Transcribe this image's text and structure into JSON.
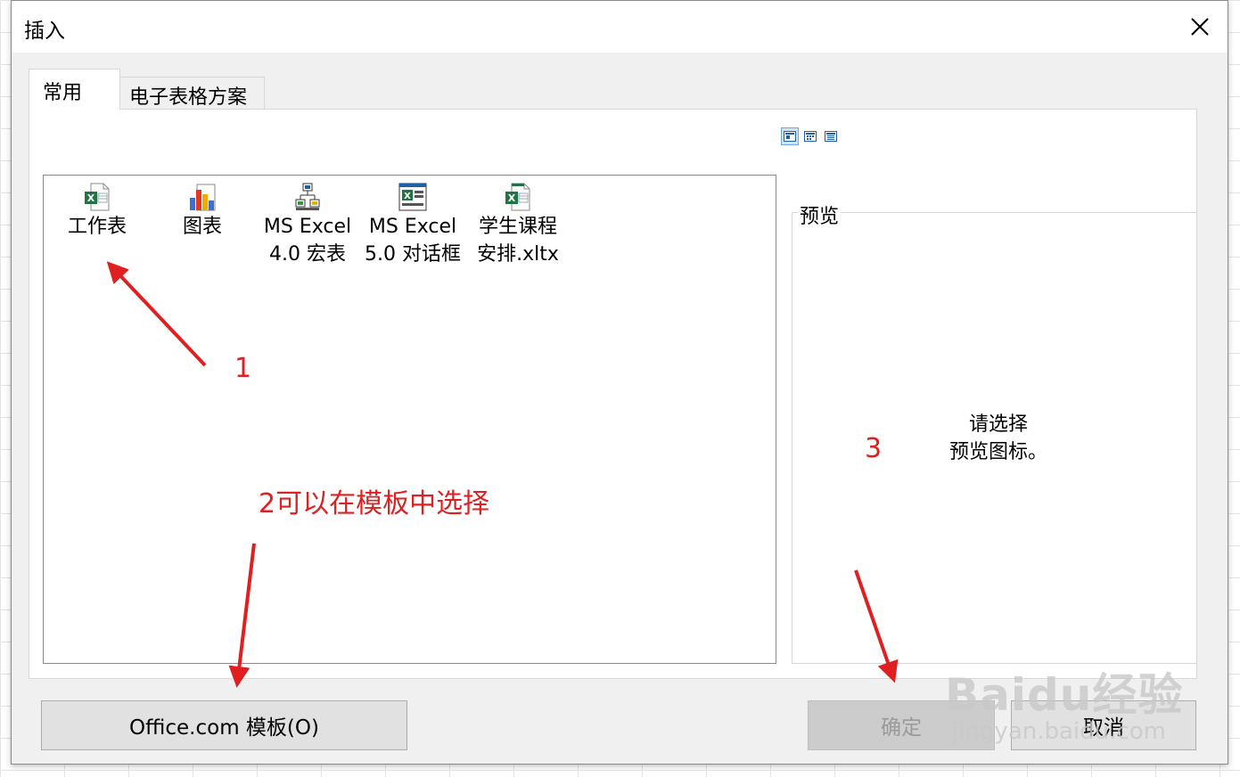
{
  "window": {
    "title": "插入"
  },
  "tabs": [
    {
      "label": "常用",
      "active": true
    },
    {
      "label": "电子表格方案",
      "active": false
    }
  ],
  "view_icons": [
    "large-icons-view-icon",
    "list-view-icon",
    "details-view-icon"
  ],
  "templates": [
    {
      "label": "工作表",
      "icon": "excel-workbook-icon"
    },
    {
      "label": "图表",
      "icon": "chart-icon"
    },
    {
      "label": "MS Excel\n4.0 宏表",
      "icon": "macro-sheet-icon"
    },
    {
      "label": "MS Excel\n5.0 对话框",
      "icon": "dialog-sheet-icon"
    },
    {
      "label": "学生课程\n安排.xltx",
      "icon": "excel-template-icon"
    }
  ],
  "preview": {
    "label": "预览",
    "message": "请选择\n预览图标。"
  },
  "buttons": {
    "office": "Office.com 模板(O)",
    "ok": "确定",
    "cancel": "取消"
  },
  "annotations": {
    "one": "1",
    "two": "2可以在模板中选择",
    "three": "3"
  },
  "watermark": {
    "main": "Baidu经验",
    "sub": "jingyan.baidu.com"
  },
  "colors": {
    "annotation": "#e02020",
    "accent": "#217346"
  }
}
